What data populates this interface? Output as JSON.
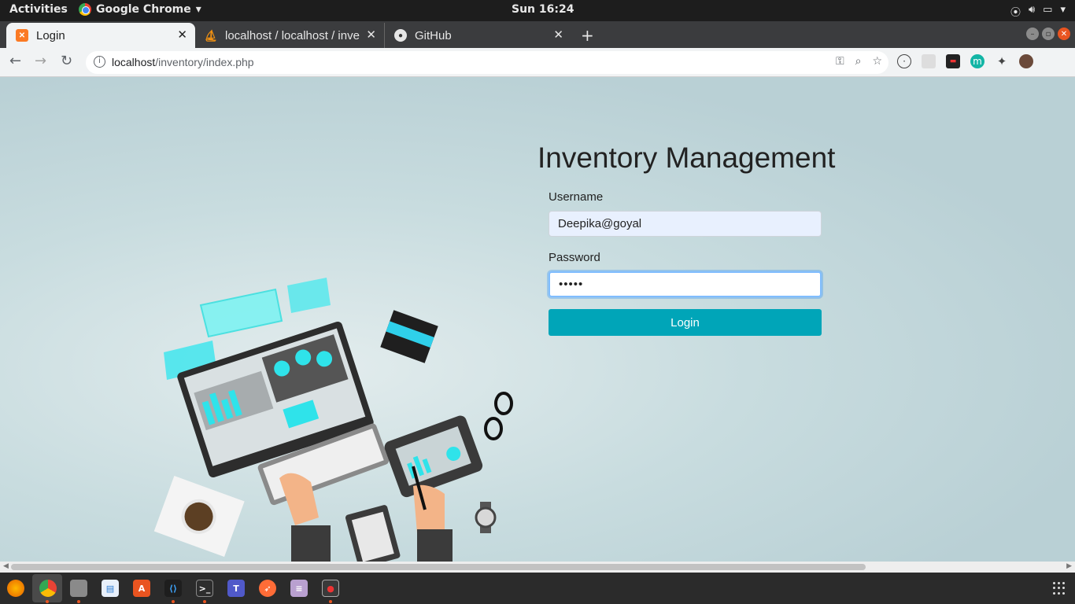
{
  "os_topbar": {
    "activities": "Activities",
    "app_name": "Google Chrome",
    "app_menu_icon": "caret-down-icon",
    "clock": "Sun 16:24",
    "tray_icons": [
      "wifi-icon",
      "volume-icon",
      "battery-icon",
      "caret-down-icon"
    ]
  },
  "tabs": [
    {
      "title": "Login",
      "icon": "xampp-icon",
      "active": true
    },
    {
      "title": "localhost / localhost / inve",
      "icon": "phpmyadmin-icon",
      "active": false
    },
    {
      "title": "GitHub",
      "icon": "github-icon",
      "active": false
    }
  ],
  "browser": {
    "url_host": "localhost",
    "url_path": "/inventory/index.php",
    "omnibox_icons": [
      "key-icon",
      "zoom-icon",
      "star-icon"
    ],
    "extension_icons": [
      "extension-circle-icon",
      "extension-square-icon",
      "mask-icon",
      "m-extension-icon",
      "puzzle-icon",
      "profile-avatar"
    ]
  },
  "login": {
    "title": "Inventory Management",
    "username_label": "Username",
    "username_value": "Deepika@goyal",
    "password_label": "Password",
    "password_value": "•••••",
    "login_button": "Login"
  },
  "dock": {
    "apps": [
      "firefox-icon",
      "chrome-icon",
      "files-icon",
      "writer-icon",
      "software-icon",
      "vscode-icon",
      "terminal-icon",
      "teams-icon",
      "postman-icon",
      "database-icon",
      "screen-recorder-icon"
    ],
    "show_apps_icon": "apps-grid-icon"
  },
  "colors": {
    "page_bg": "#b9d0d5",
    "login_button": "#00a5b8",
    "autofill_bg": "#e8f0fe",
    "focus_border": "#80bdff"
  }
}
